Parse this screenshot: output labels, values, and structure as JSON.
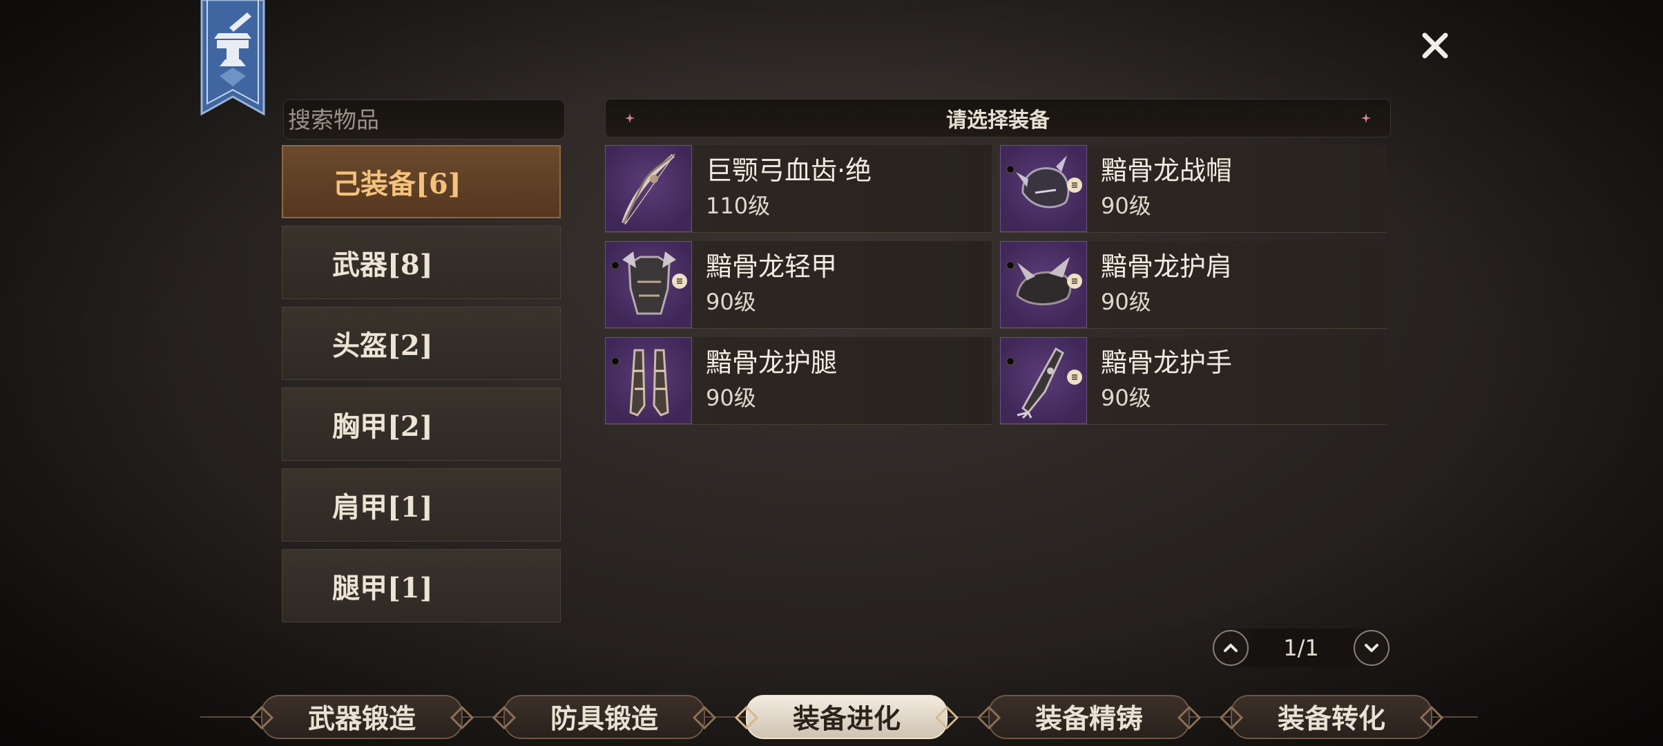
{
  "search": {
    "placeholder": "搜索物品"
  },
  "categories": [
    {
      "label": "己装备[6]",
      "active": true
    },
    {
      "label": "武器[8]"
    },
    {
      "label": "头盔[2]"
    },
    {
      "label": "胸甲[2]"
    },
    {
      "label": "肩甲[1]"
    },
    {
      "label": "腿甲[1]"
    }
  ],
  "header": {
    "title": "请选择装备"
  },
  "items": [
    {
      "name": "巨颚弓血齿·绝",
      "level": "110级",
      "icon": "bow-icon"
    },
    {
      "name": "黯骨龙战帽",
      "level": "90级",
      "icon": "helmet-icon"
    },
    {
      "name": "黯骨龙轻甲",
      "level": "90级",
      "icon": "chest-armor-icon"
    },
    {
      "name": "黯骨龙护肩",
      "level": "90级",
      "icon": "shoulder-armor-icon"
    },
    {
      "name": "黯骨龙护腿",
      "level": "90级",
      "icon": "leg-armor-icon"
    },
    {
      "name": "黯骨龙护手",
      "level": "90级",
      "icon": "gauntlet-icon"
    }
  ],
  "pager": {
    "label": "1/1"
  },
  "tabs": [
    {
      "label": "武器锻造"
    },
    {
      "label": "防具锻造"
    },
    {
      "label": "装备进化",
      "active": true
    },
    {
      "label": "装备精铸"
    },
    {
      "label": "装备转化"
    }
  ],
  "colors": {
    "accent": "#f4c27c",
    "thumb_bg": "#4a2f66",
    "banner": "#4a6ea3"
  }
}
